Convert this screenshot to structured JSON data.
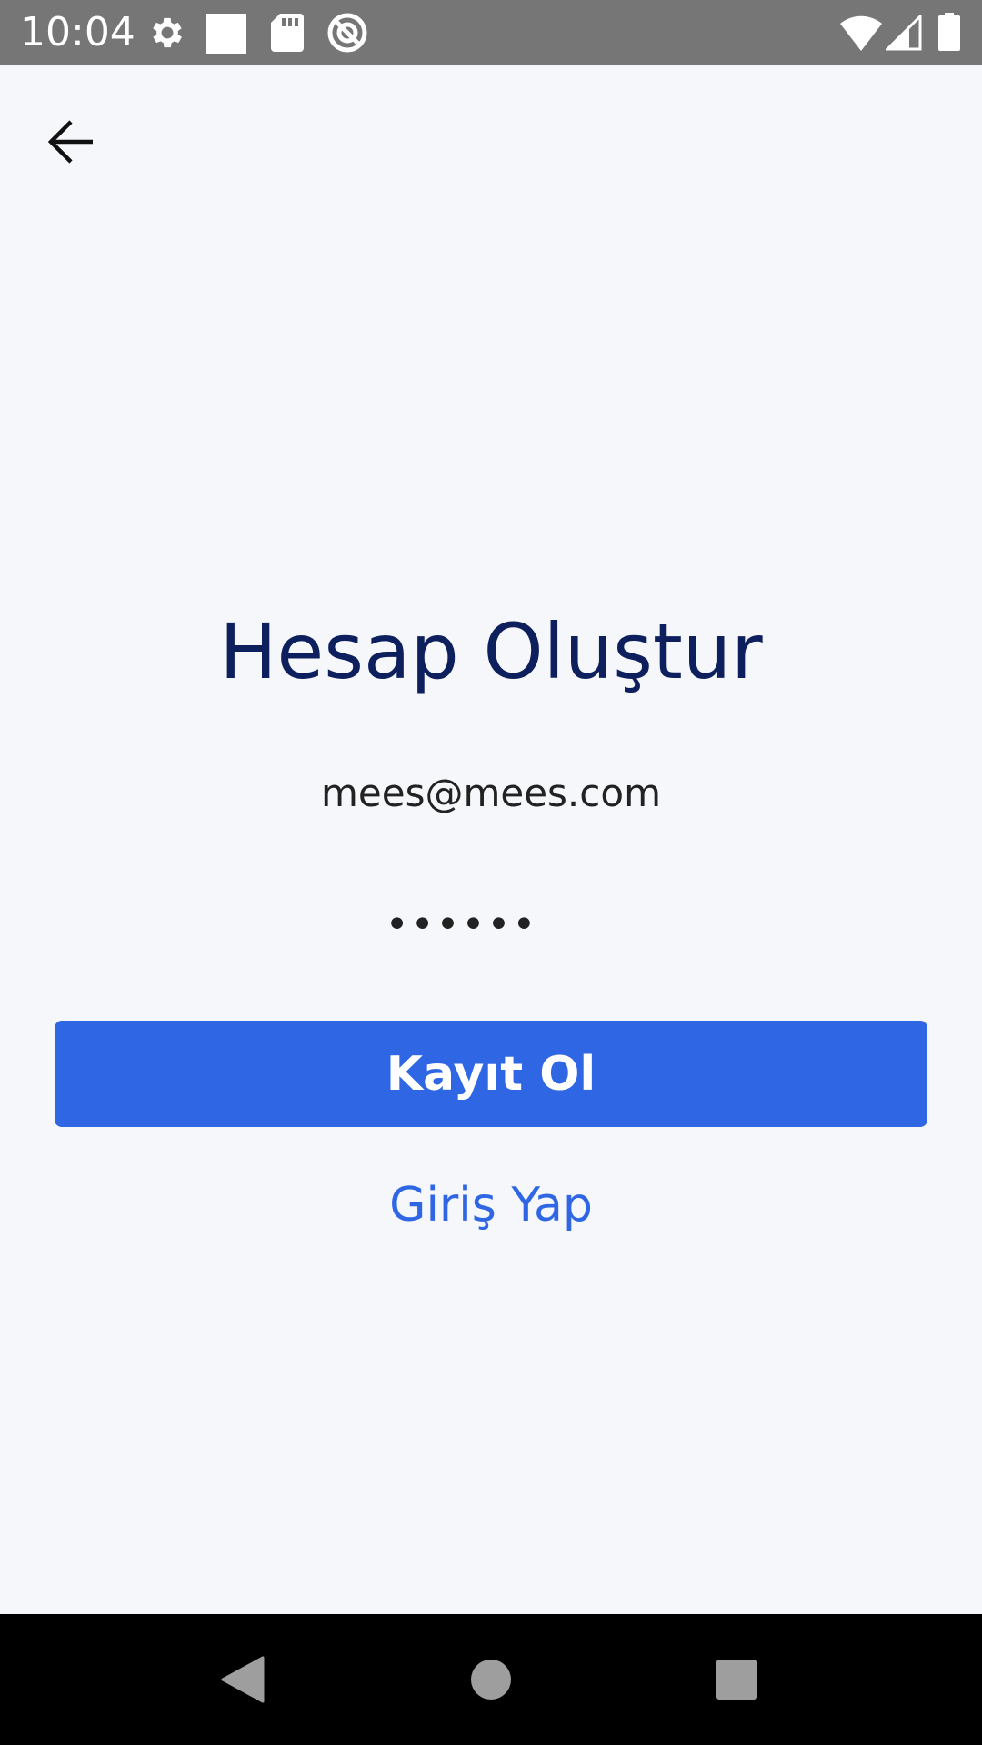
{
  "status_bar": {
    "time": "10:04",
    "background_color": "#767676",
    "left_icons": [
      "settings-gear-icon",
      "white-square-icon",
      "sd-card-icon",
      "data-saver-icon"
    ],
    "right_icons": [
      "wifi-icon",
      "cellular-signal-icon",
      "battery-icon"
    ]
  },
  "header": {
    "back_icon": "arrow-back-icon"
  },
  "form": {
    "title": "Hesap Oluştur",
    "email_value": "mees@mees.com",
    "password_value": "••••••",
    "register_button_label": "Kayıt Ol",
    "login_link_label": "Giriş Yap"
  },
  "colors": {
    "background": "#f6f7fb",
    "title": "#0d1f5c",
    "accent": "#2f66e4",
    "text": "#222222"
  },
  "nav_bar": {
    "buttons": [
      "back-triangle-icon",
      "home-circle-icon",
      "recents-square-icon"
    ]
  }
}
